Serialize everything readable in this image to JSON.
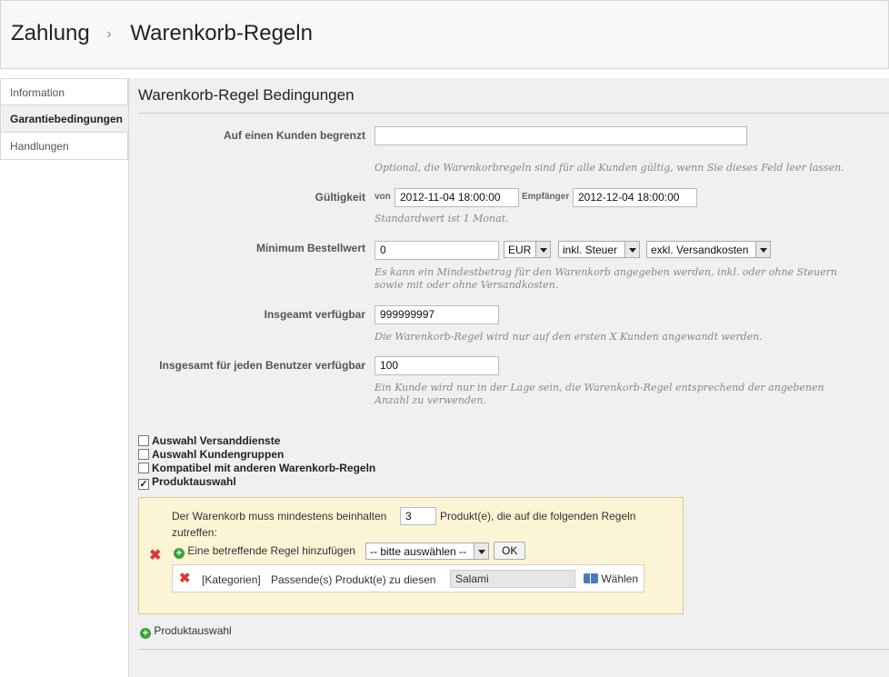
{
  "header": {
    "crumb_parent": "Zahlung",
    "crumb_sep": "›",
    "crumb_current": "Warenkorb-Regeln"
  },
  "sidebar": {
    "items": [
      {
        "label": "Information"
      },
      {
        "label": "Garantiebedingungen"
      },
      {
        "label": "Handlungen"
      }
    ]
  },
  "panel": {
    "title": "Warenkorb-Regel Bedingungen"
  },
  "customer": {
    "label": "Auf einen Kunden begrenzt",
    "value": "",
    "hint": "Optional, die Warenkorbregeln sind für alle Kunden gültig, wenn Sie dieses Feld leer lassen."
  },
  "validity": {
    "label": "Gültigkeit",
    "from_label": "von",
    "from_value": "2012-11-04 18:00:00",
    "to_label": "Empfänger",
    "to_value": "2012-12-04 18:00:00",
    "hint": "Standardwert ist 1 Monat."
  },
  "minimum": {
    "label": "Minimum Bestellwert",
    "value": "0",
    "currency": "EUR",
    "tax": "inkl. Steuer",
    "shipping": "exkl. Versandkosten",
    "hint_line1": "Es kann ein Mindestbetrag für den Warenkorb angegeben werden, inkl. oder ohne Steuern",
    "hint_line2": "sowie mit oder ohne Versandkosten."
  },
  "total_available": {
    "label": "Insgeamt verfügbar",
    "value": "999999997",
    "hint": "Die Warenkorb-Regel wird nur auf den ersten X Kunden angewandt werden."
  },
  "per_user": {
    "label": "Insgesamt für jeden Benutzer verfügbar",
    "value": "100",
    "hint_line1": "Ein Kunde wird nur in der Lage sein, die Warenkorb-Regel entsprechend der angebenen",
    "hint_line2": "Anzahl zu verwenden."
  },
  "checkboxes": [
    {
      "label": "Auswahl Versanddienste",
      "checked": false
    },
    {
      "label": "Auswahl Kundengruppen",
      "checked": false
    },
    {
      "label": "Kompatibel mit anderen Warenkorb-Regeln",
      "checked": false
    },
    {
      "label": "Produktauswahl",
      "checked": true,
      "mark": "✓"
    }
  ],
  "rule": {
    "text_before": "Der Warenkorb muss mindestens beinhalten",
    "quantity": "3",
    "text_after": "Produkt(e), die auf die folgenden Regeln",
    "text_line2": "zutreffen:",
    "add_rule_label": "Eine betreffende Regel hinzufügen",
    "select_value": "-- bitte auswählen --",
    "ok_label": "OK",
    "item_type": "[Kategorien]",
    "item_text": "Passende(s) Produkt(e) zu diesen",
    "item_value": "Salami",
    "choose_label": "Wählen"
  },
  "add_product_selection": "Produktauswahl",
  "colors": {
    "panel_bg": "#f0f0f0",
    "rule_bg": "#fcf5d5",
    "remove": "#d63b3b",
    "add": "#3aa33a"
  }
}
